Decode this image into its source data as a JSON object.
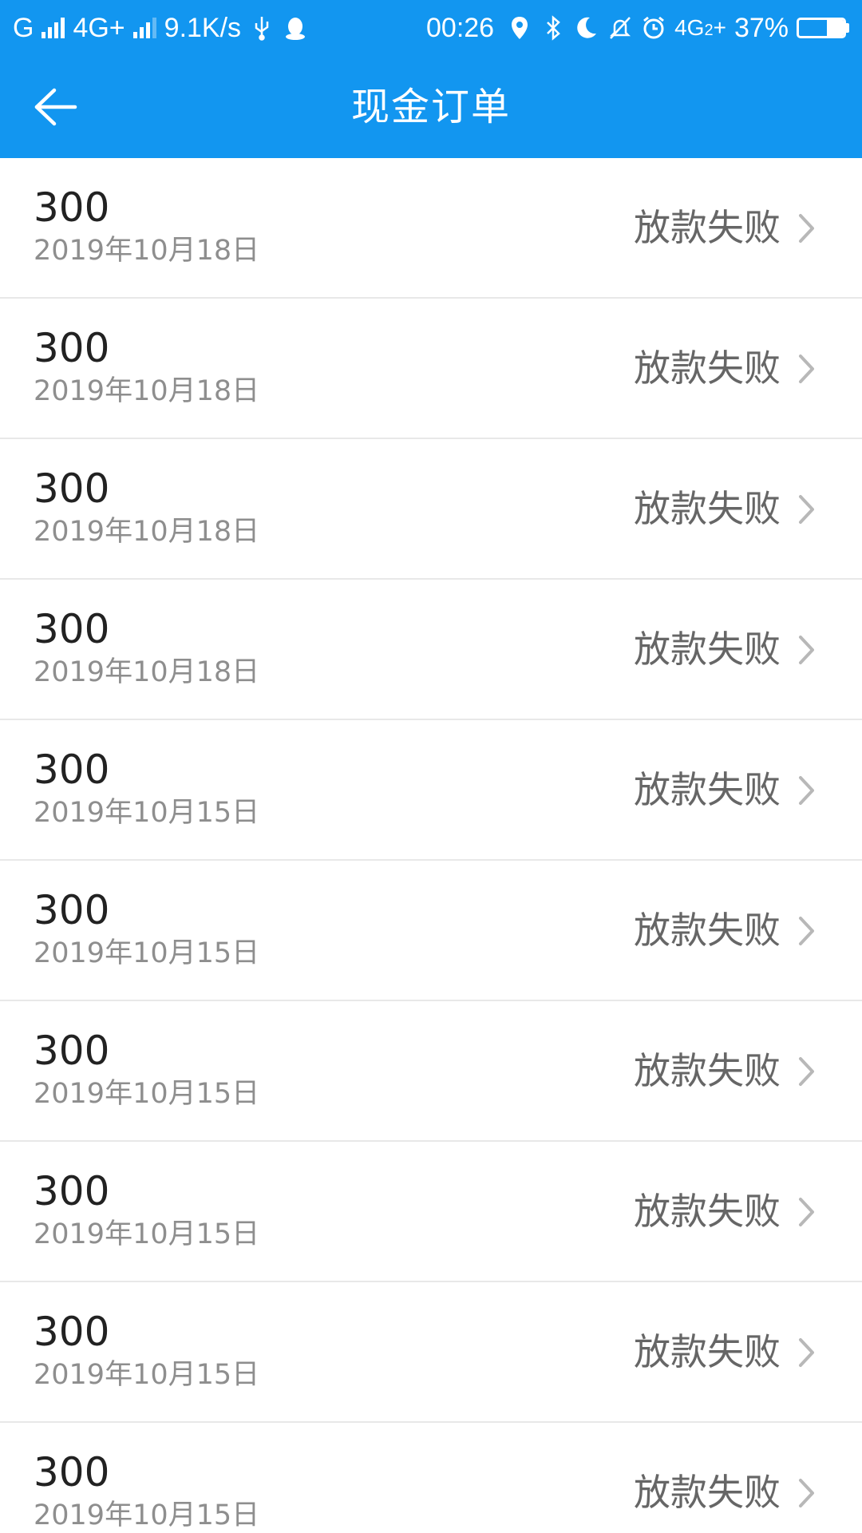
{
  "status_bar": {
    "carrier_1": "G",
    "network_2": "4G+",
    "speed": "9.1K/s",
    "time": "00:26",
    "network_3": "4G",
    "sim_index": "2",
    "battery_text": "37%",
    "battery_level": 0.37,
    "icons": [
      "signal-icon",
      "signal-icon",
      "usb-icon",
      "qq-icon",
      "location-icon",
      "bluetooth-icon",
      "moon-icon",
      "bell-off-icon",
      "alarm-icon",
      "battery-charging-icon"
    ]
  },
  "header": {
    "title": "现金订单",
    "back_icon": "arrow-left-icon"
  },
  "orders": [
    {
      "amount": "300",
      "date": "2019年10月18日",
      "status": "放款失败"
    },
    {
      "amount": "300",
      "date": "2019年10月18日",
      "status": "放款失败"
    },
    {
      "amount": "300",
      "date": "2019年10月18日",
      "status": "放款失败"
    },
    {
      "amount": "300",
      "date": "2019年10月18日",
      "status": "放款失败"
    },
    {
      "amount": "300",
      "date": "2019年10月15日",
      "status": "放款失败"
    },
    {
      "amount": "300",
      "date": "2019年10月15日",
      "status": "放款失败"
    },
    {
      "amount": "300",
      "date": "2019年10月15日",
      "status": "放款失败"
    },
    {
      "amount": "300",
      "date": "2019年10月15日",
      "status": "放款失败"
    },
    {
      "amount": "300",
      "date": "2019年10月15日",
      "status": "放款失败"
    },
    {
      "amount": "300",
      "date": "2019年10月15日",
      "status": "放款失败"
    }
  ],
  "colors": {
    "primary": "#1296f0",
    "amount_text": "#222222",
    "date_text": "#8e8e8e",
    "status_text": "#666666",
    "chevron": "#b8b8b8",
    "divider": "#e8e8e8"
  }
}
